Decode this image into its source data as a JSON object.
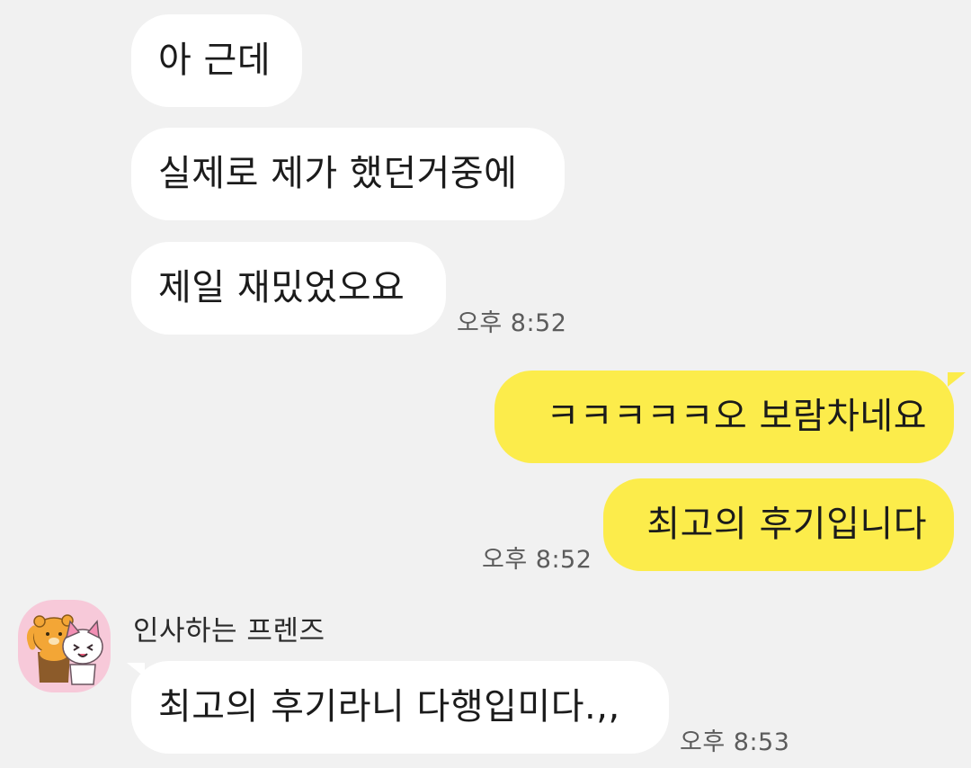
{
  "messages": [
    {
      "text": "아 근데"
    },
    {
      "text": "실제로 제가 했던거중에"
    },
    {
      "text": "제일 재밌었오요",
      "time": "오후 8:52"
    },
    {
      "text": "ㅋㅋㅋㅋㅋ오 보람차네요"
    },
    {
      "text": "최고의 후기입니다",
      "time": "오후 8:52"
    },
    {
      "text": "최고의 후기라니 다행입미다.,,",
      "time": "오후 8:53"
    }
  ],
  "sender": {
    "name": "인사하는 프렌즈",
    "avatar_icon": "friends-avatar-icon"
  },
  "colors": {
    "background": "#f1f1f1",
    "incoming_bubble": "#ffffff",
    "outgoing_bubble": "#fcec4b",
    "time_text": "#5c5c5c"
  }
}
